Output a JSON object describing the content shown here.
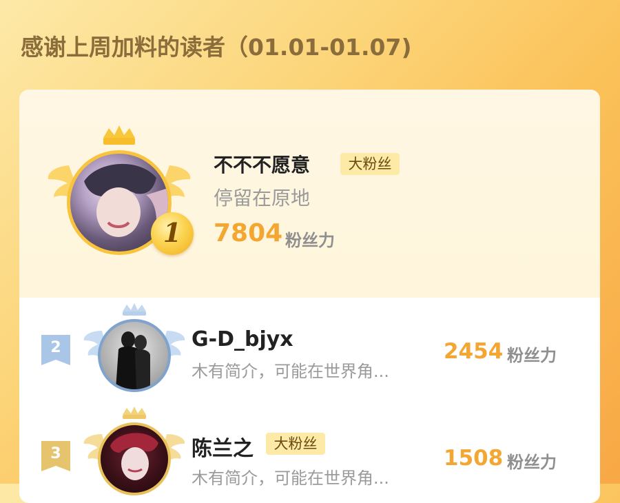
{
  "header": {
    "title": "感谢上周加料的读者（01.01-01.07)"
  },
  "ranking": [
    {
      "rank": "1",
      "name": "不不不愿意",
      "badge": "大粉丝",
      "bio": "停留在原地",
      "score": "7804",
      "unit": "粉丝力",
      "crown_color": "#f7c945"
    },
    {
      "rank": "2",
      "name": "G-D_bjyx",
      "badge": "",
      "bio": "木有简介，可能在世界角...",
      "score": "2454",
      "unit": "粉丝力",
      "crown_color": "#b7d3ec"
    },
    {
      "rank": "3",
      "name": "陈兰之",
      "badge": "大粉丝",
      "bio": "木有简介，可能在世界角...",
      "score": "1508",
      "unit": "粉丝力",
      "crown_color": "#f2d58a"
    }
  ],
  "icons": {
    "crown": "crown-icon",
    "wings": "wings-icon",
    "medal": "medal-icon",
    "rank_flag": "rank-flag-icon"
  }
}
